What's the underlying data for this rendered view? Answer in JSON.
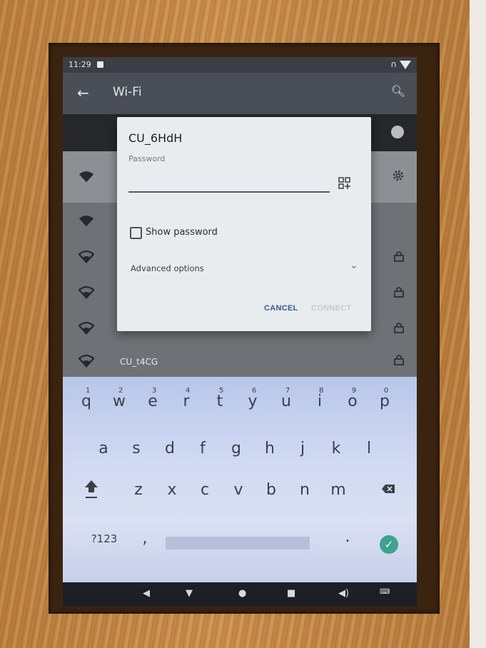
{
  "status_bar": {
    "time": "11:29"
  },
  "app_bar": {
    "title": "Wi-Fi"
  },
  "dialog": {
    "network_name": "CU_6HdH",
    "password_label": "Password",
    "password_value": "",
    "show_password_label": "Show password",
    "advanced_options_label": "Advanced options",
    "cancel_label": "CANCEL",
    "connect_label": "CONNECT"
  },
  "network_list": {
    "visible_name": "CU_t4CG"
  },
  "keyboard": {
    "row1": [
      {
        "letter": "q",
        "number": "1"
      },
      {
        "letter": "w",
        "number": "2"
      },
      {
        "letter": "e",
        "number": "3"
      },
      {
        "letter": "r",
        "number": "4"
      },
      {
        "letter": "t",
        "number": "5"
      },
      {
        "letter": "y",
        "number": "6"
      },
      {
        "letter": "u",
        "number": "7"
      },
      {
        "letter": "i",
        "number": "8"
      },
      {
        "letter": "o",
        "number": "9"
      },
      {
        "letter": "p",
        "number": "0"
      }
    ],
    "row2": [
      "a",
      "s",
      "d",
      "f",
      "g",
      "h",
      "j",
      "k",
      "l"
    ],
    "row3": [
      "z",
      "x",
      "c",
      "v",
      "b",
      "n",
      "m"
    ],
    "symbols_label": "?123",
    "comma": ",",
    "period": "."
  },
  "colors": {
    "accent": "#3fa28a",
    "dialog_bg": "#e9ecef",
    "link": "#3b5b8c"
  }
}
